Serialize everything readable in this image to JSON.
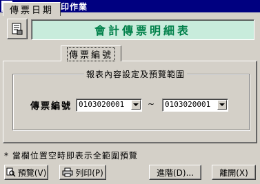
{
  "window": {
    "title": "會計傳票列印作業",
    "app_icon_glyph": "財"
  },
  "header": {
    "title": "會計傳票明細表"
  },
  "tabs": [
    {
      "label": "傳票日期",
      "active": false
    },
    {
      "label": "傳票編號",
      "active": true
    }
  ],
  "group": {
    "title": "報表內容設定及預覽範圍",
    "field_label": "傳票編號",
    "from_value": "0103020001",
    "separator": "~",
    "to_value": "0103020001"
  },
  "note": "* 當欄位置空時即表示全範圍預覽",
  "buttons": {
    "preview": "預覽(V)",
    "print": "列印(P)",
    "advanced": "進階(D)...",
    "exit": "離開(X)"
  },
  "colors": {
    "titlebar": "#000080",
    "header_bg": "#c8ecdc",
    "header_text": "#00804a"
  }
}
